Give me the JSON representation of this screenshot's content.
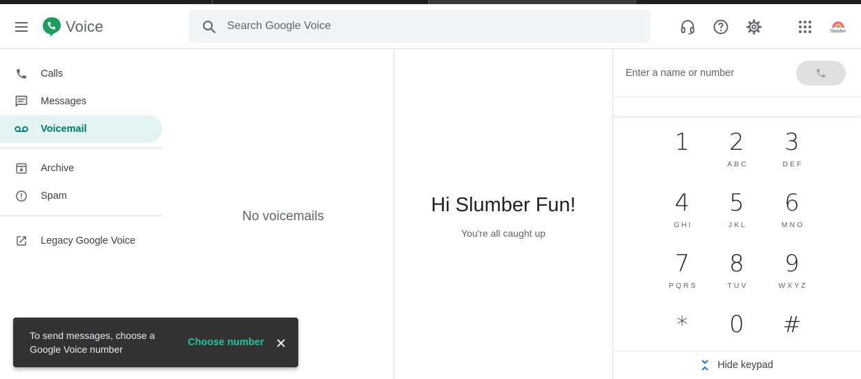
{
  "app": {
    "title": "Voice"
  },
  "search": {
    "placeholder": "Search Google Voice"
  },
  "header": {
    "icons": [
      "headset-icon",
      "help-icon",
      "settings-icon",
      "apps-grid-icon"
    ],
    "avatar_text": "Slumber"
  },
  "sidebar": {
    "items": [
      {
        "label": "Calls",
        "icon": "phone-icon"
      },
      {
        "label": "Messages",
        "icon": "message-icon"
      },
      {
        "label": "Voicemail",
        "icon": "voicemail-icon",
        "active": true
      },
      {
        "label": "Archive",
        "icon": "archive-icon"
      },
      {
        "label": "Spam",
        "icon": "spam-icon"
      },
      {
        "label": "Legacy Google Voice",
        "icon": "open-external-icon"
      }
    ]
  },
  "list": {
    "empty_message": "No voicemails"
  },
  "welcome": {
    "greeting": "Hi Slumber Fun!",
    "subtitle": "You're all caught up"
  },
  "dialer": {
    "placeholder": "Enter a name or number",
    "keys": [
      {
        "digit": "1",
        "letters": ""
      },
      {
        "digit": "2",
        "letters": "ABC"
      },
      {
        "digit": "3",
        "letters": "DEF"
      },
      {
        "digit": "4",
        "letters": "GHI"
      },
      {
        "digit": "5",
        "letters": "JKL"
      },
      {
        "digit": "6",
        "letters": "MNO"
      },
      {
        "digit": "7",
        "letters": "PQRS"
      },
      {
        "digit": "8",
        "letters": "TUV"
      },
      {
        "digit": "9",
        "letters": "WXYZ"
      },
      {
        "digit": "*",
        "letters": ""
      },
      {
        "digit": "0",
        "letters": ""
      },
      {
        "digit": "#",
        "letters": ""
      }
    ],
    "hide_label": "Hide keypad"
  },
  "snackbar": {
    "text": "To send messages, choose a Google Voice number",
    "action": "Choose number"
  },
  "colors": {
    "brand_green": "#1e9e5e",
    "active_bg": "#e3f3f1",
    "active_text": "#00796b",
    "snackbar_bg": "#323232",
    "snackbar_action": "#1ec4a7"
  }
}
